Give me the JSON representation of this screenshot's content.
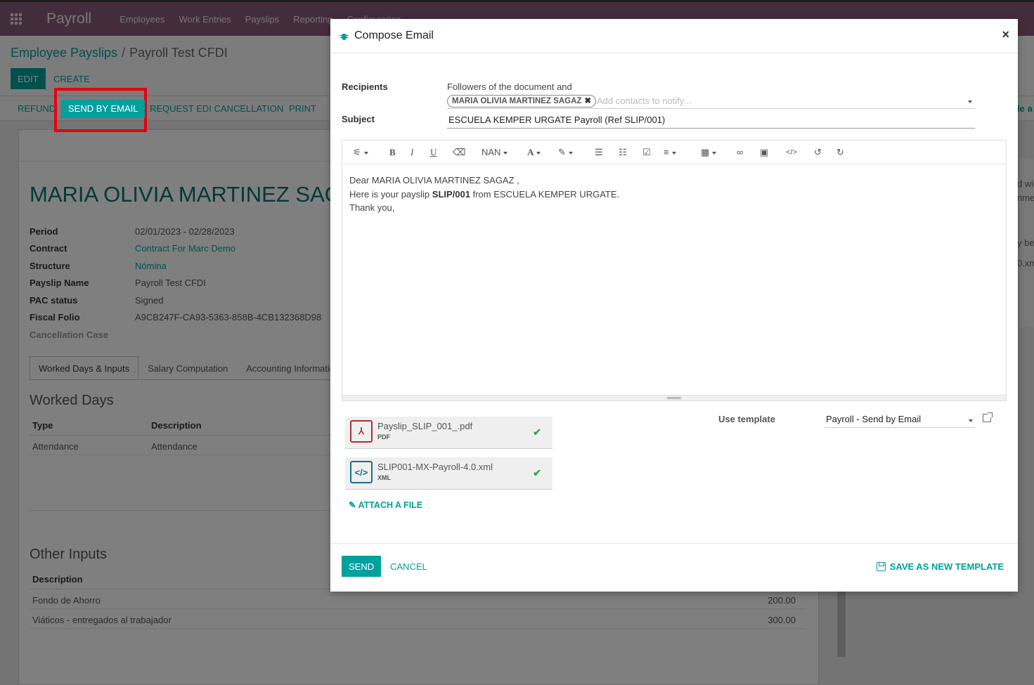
{
  "topbar": {
    "app_title": "Payroll",
    "menu": [
      "Employees",
      "Work Entries",
      "Payslips",
      "Reporting",
      "Configuration"
    ]
  },
  "breadcrumb": {
    "parent": "Employee Payslips",
    "separator": "/",
    "current": "Payroll Test CFDI"
  },
  "control": {
    "edit_label": "EDIT",
    "create_label": "CREATE"
  },
  "statusbar": {
    "refund_label": "REFUND",
    "send_email_label": "SEND BY EMAIL",
    "request_cancel_label": "REQUEST EDI CANCELLATION",
    "print_label": "PRINT"
  },
  "payslip": {
    "employee_name": "MARIA OLIVIA MARTINEZ SAGAZ",
    "fields": [
      {
        "label": "Period",
        "value": "02/01/2023 - 02/28/2023"
      },
      {
        "label": "Contract",
        "value": "Contract For Marc Demo"
      },
      {
        "label": "Structure",
        "value": "Nómina"
      },
      {
        "label": "Payslip Name",
        "value": "Payroll Test CFDI"
      },
      {
        "label": "PAC status",
        "value": "Signed"
      },
      {
        "label": "Fiscal Folio",
        "value": "A9CB247F-CA93-5363-858B-4CB132368D98"
      },
      {
        "label": "Cancellation Case",
        "value": ""
      }
    ],
    "tabs": [
      "Worked Days & Inputs",
      "Salary Computation",
      "Accounting Information"
    ],
    "worked_days": {
      "title": "Worked Days",
      "headers": [
        "Type",
        "Description"
      ],
      "rows": [
        [
          "Attendance",
          "Attendance"
        ]
      ]
    },
    "other_inputs": {
      "title": "Other Inputs",
      "header": "Description",
      "rows": [
        {
          "description": "Fondo de Ahorro",
          "amount": "200.00"
        },
        {
          "description": "Viáticos - entregados al trabajador",
          "amount": "300.00"
        }
      ]
    }
  },
  "side_text": [
    "d wi",
    "nme",
    "y be",
    "0.xm",
    "le a"
  ],
  "modal": {
    "title": "Compose Email",
    "close": "×",
    "recipients_label": "Recipients",
    "followers_text": "Followers of the document and",
    "recipient_tag": "MARIA OLIVIA MARTINEZ SAGAZ",
    "recipient_placeholder": "Add contacts to notify...",
    "subject_label": "Subject",
    "subject_value": "ESCUELA KEMPER URGATE Payroll (Ref SLIP/001)",
    "toolbar": {
      "font_size": "NAN"
    },
    "body": {
      "line1": "Dear MARIA OLIVIA MARTINEZ SAGAZ ,",
      "line2_pre": "Here is your payslip ",
      "line2_bold": "SLIP/001",
      "line2_post": " from ESCUELA KEMPER URGATE.",
      "line3": "Thank you,"
    },
    "attachments": [
      {
        "name": "Payslip_SLIP_001_.pdf",
        "ext": "PDF",
        "icon": "pdf-file-icon"
      },
      {
        "name": "SLIP001-MX-Payroll-4.0.xml",
        "ext": "XML",
        "icon": "code-file-icon"
      }
    ],
    "attach_label": "ATTACH A FILE",
    "template_label": "Use template",
    "template_value": "Payroll - Send by Email",
    "send_label": "SEND",
    "cancel_label": "CANCEL",
    "save_template_label": "SAVE AS NEW TEMPLATE"
  }
}
